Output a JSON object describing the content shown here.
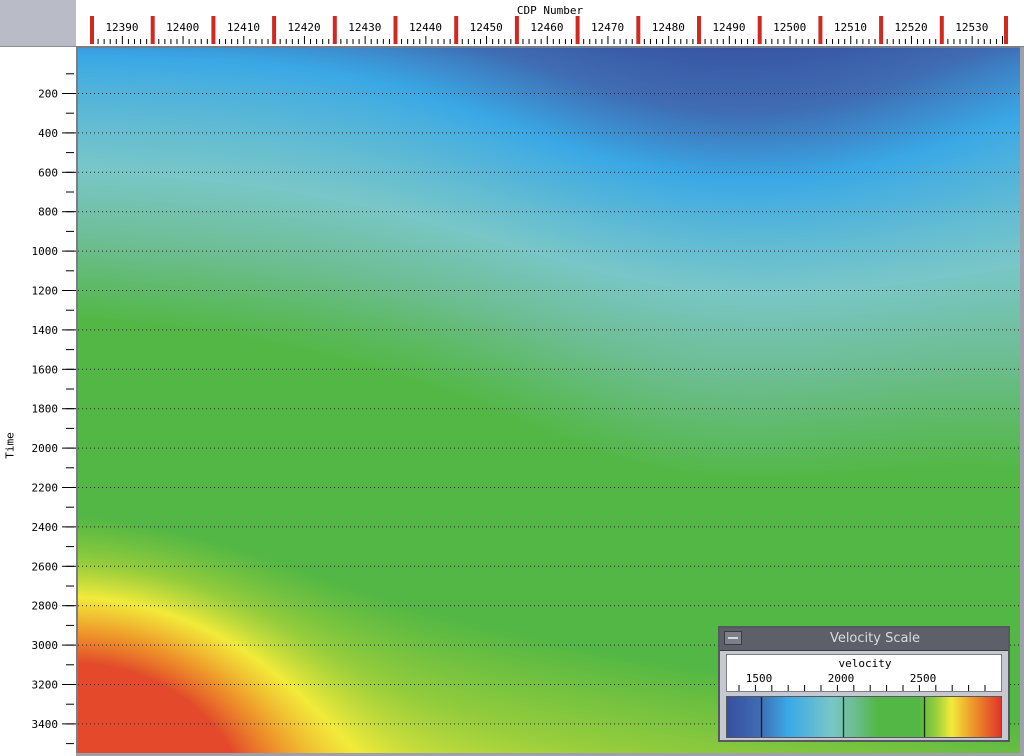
{
  "axes": {
    "x_title": "CDP Number",
    "y_title": "Time",
    "x_labels": [
      "12390",
      "12400",
      "12410",
      "12420",
      "12430",
      "12440",
      "12450",
      "12460",
      "12470",
      "12480",
      "12490",
      "12500",
      "12510",
      "12520",
      "12530"
    ],
    "y_labels": [
      "200",
      "400",
      "600",
      "800",
      "1000",
      "1200",
      "1400",
      "1600",
      "1800",
      "2000",
      "2200",
      "2400",
      "2600",
      "2800",
      "3000",
      "3200",
      "3400"
    ]
  },
  "velocity_scale": {
    "title": "Velocity Scale",
    "label": "velocity",
    "ticks": [
      "1500",
      "2000",
      "2500"
    ]
  },
  "colors": {
    "deep_blue": "#3f6db3",
    "light_blue": "#3aa8e6",
    "aqua": "#79c7c8",
    "green": "#52b744",
    "yellow": "#f2eb3a",
    "orange": "#ee8a2a",
    "red": "#e0362a",
    "tick_red": "#d02a20"
  }
}
